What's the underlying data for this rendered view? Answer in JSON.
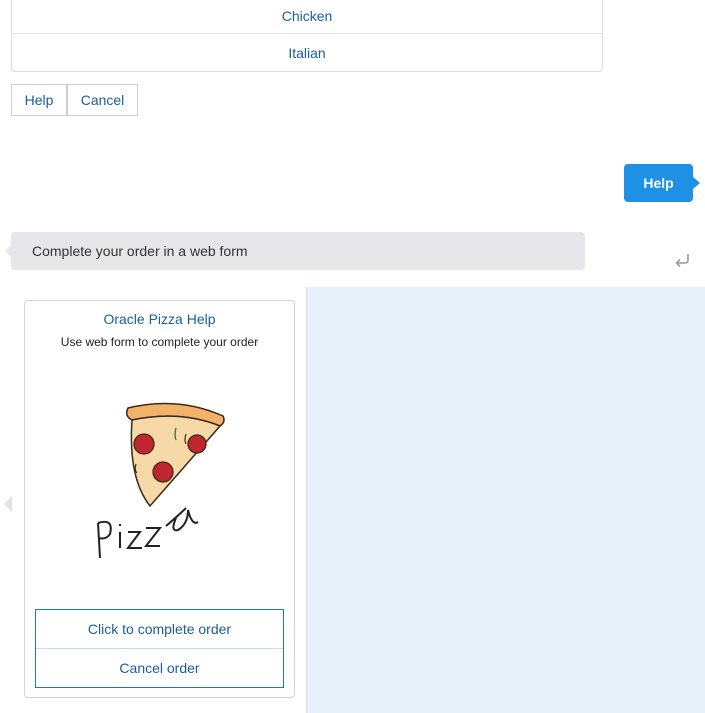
{
  "options": [
    "Chicken",
    "Italian"
  ],
  "quick_actions": {
    "help": "Help",
    "cancel": "Cancel"
  },
  "user_message": "Help",
  "bot_message": "Complete your order in a web form",
  "icons": {
    "reply": "reply-arrow-icon",
    "pizza": "pizza-illustration"
  },
  "card": {
    "title": "Oracle Pizza Help",
    "description": "Use web form to complete your order",
    "image_caption": "Pizza",
    "actions": [
      "Click to complete order",
      "Cancel order"
    ]
  },
  "colors": {
    "link": "#1a5e9e",
    "user_bubble": "#1e90e6",
    "bot_bubble": "#e7e7ea",
    "card_area_bg": "#e6f1f9",
    "pepperoni": "#c0262f"
  }
}
